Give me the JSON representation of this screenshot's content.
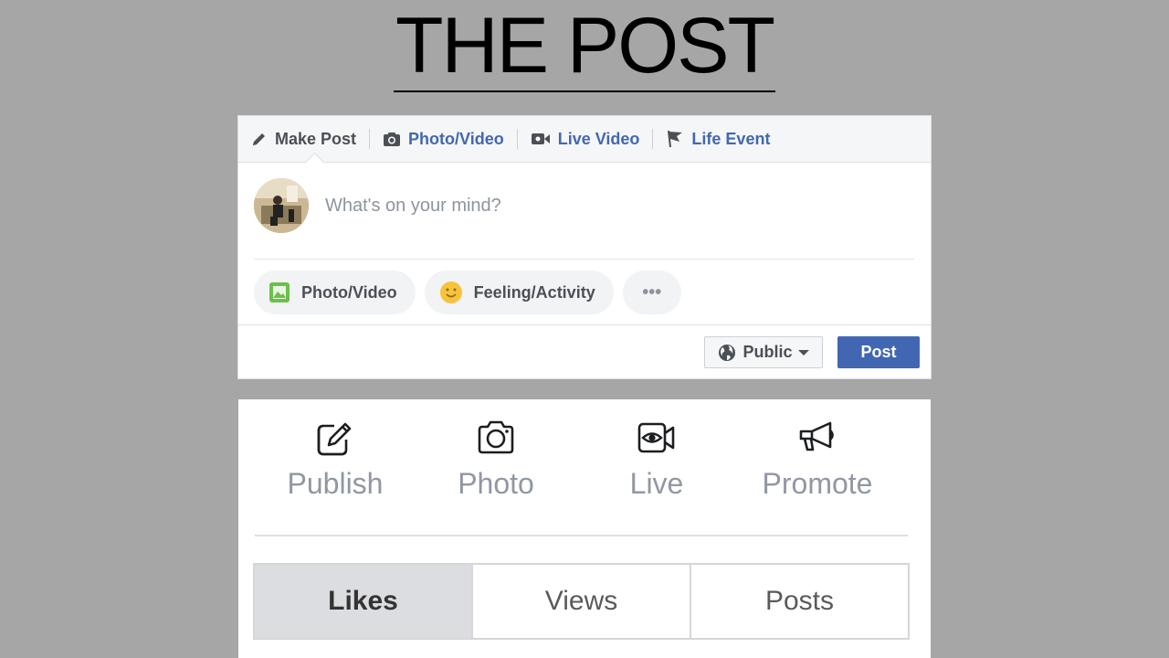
{
  "slide": {
    "title": "THE POST"
  },
  "composer": {
    "tabs": [
      {
        "label": "Make Post",
        "icon": "pencil-icon"
      },
      {
        "label": "Photo/Video",
        "icon": "camera-icon"
      },
      {
        "label": "Live Video",
        "icon": "video-camera-icon"
      },
      {
        "label": "Life Event",
        "icon": "flag-icon"
      }
    ],
    "placeholder": "What's on your mind?",
    "actions": [
      {
        "label": "Photo/Video",
        "icon": "photo-icon"
      },
      {
        "label": "Feeling/Activity",
        "icon": "smiley-icon"
      },
      {
        "label": "•••",
        "icon": "more-icon"
      }
    ],
    "privacy": "Public",
    "post_label": "Post",
    "colors": {
      "accent": "#4267b2",
      "tab_bg": "#f5f6f7",
      "photo_green": "#6bc049",
      "feeling_yellow": "#f7c33c"
    }
  },
  "page_panel": {
    "quick_actions": [
      {
        "label": "Publish",
        "icon": "edit-icon"
      },
      {
        "label": "Photo",
        "icon": "camera-icon"
      },
      {
        "label": "Live",
        "icon": "live-video-icon"
      },
      {
        "label": "Promote",
        "icon": "megaphone-icon"
      }
    ],
    "stats_tabs": [
      {
        "label": "Likes",
        "active": true
      },
      {
        "label": "Views",
        "active": false
      },
      {
        "label": "Posts",
        "active": false
      }
    ]
  }
}
